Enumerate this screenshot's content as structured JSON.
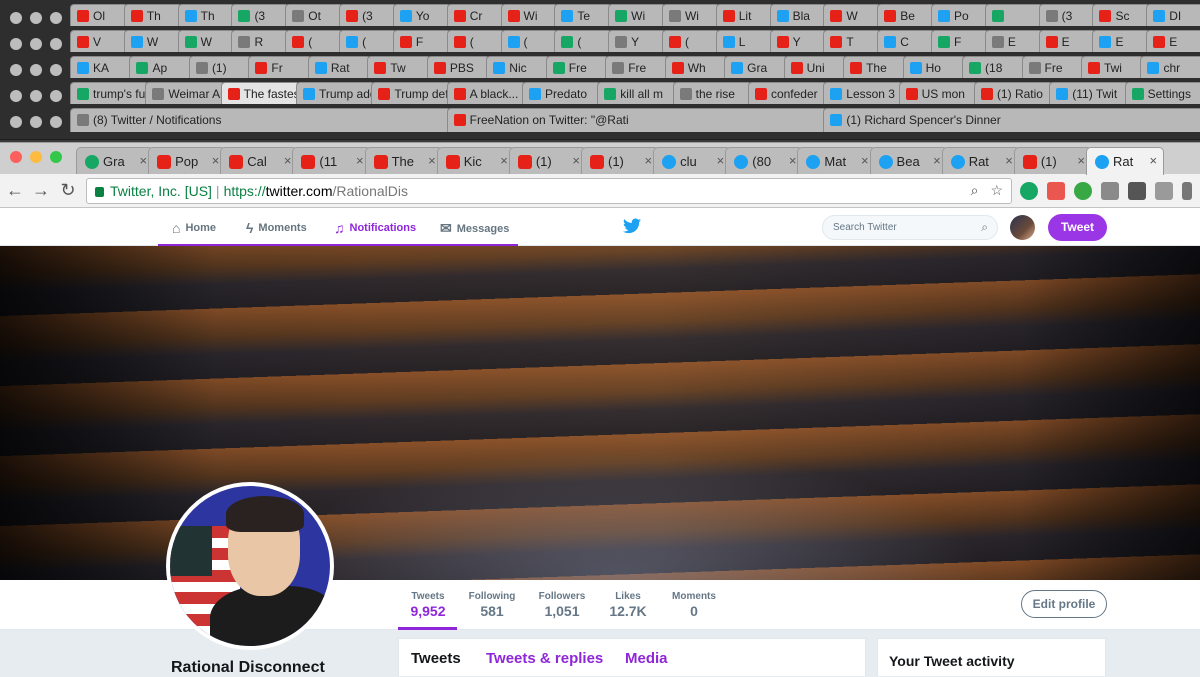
{
  "background_windows": [
    {
      "tabs": [
        "Ol",
        "Th",
        "Th",
        "(3",
        "Ot",
        "(3",
        "Yo",
        "Cr",
        "Wi",
        "Te",
        "Wi",
        "Wi",
        "Lit",
        "Bla",
        "W",
        "Be",
        "Po",
        "",
        "(3",
        "Sc",
        "DI"
      ]
    },
    {
      "tabs": [
        "V",
        "W",
        "W",
        "R",
        "(",
        "(",
        "F",
        "(",
        "(",
        "(",
        "Y",
        "(",
        "L",
        "Y",
        "T",
        "C",
        "F",
        "E",
        "E",
        "E",
        "E"
      ]
    },
    {
      "tabs": [
        "KA",
        "Ap",
        "(1)",
        "Fr",
        "Rat",
        "Tw",
        "PBS",
        "Nic",
        "Fre",
        "Fre",
        "Wh",
        "Gra",
        "Uni",
        "The",
        "Ho",
        "(18",
        "Fre",
        "Twi",
        "chr"
      ]
    },
    {
      "tabs": [
        "trump's full response to ch",
        "Weimar America - YouTube",
        "The fastest free YouTube D",
        "Trump addresses Charlotte",
        "Trump defends Charlottesvil",
        "A black...",
        "Predato",
        "kill all m",
        "the rise",
        "confeder",
        "Lesson 3",
        "US mon",
        "(1) Ratio",
        "(11) Twit",
        "Settings"
      ]
    },
    {
      "tabs": [
        "(8) Twitter / Notifications",
        "FreeNation on Twitter: \"@Rati",
        "(1) Richard Spencer's Dinner"
      ]
    }
  ],
  "active_tabs": [
    {
      "label": "Gra",
      "icon": "grammarly-icon"
    },
    {
      "label": "Pop",
      "icon": "youtube-icon"
    },
    {
      "label": "Cal",
      "icon": "youtube-icon"
    },
    {
      "label": "(11",
      "icon": "youtube-icon"
    },
    {
      "label": "The",
      "icon": "youtube-icon"
    },
    {
      "label": "Kic",
      "icon": "youtube-icon"
    },
    {
      "label": "(1)",
      "icon": "youtube-icon"
    },
    {
      "label": "(1)",
      "icon": "youtube-icon"
    },
    {
      "label": "clu",
      "icon": "twitter-icon"
    },
    {
      "label": "(80",
      "icon": "twitter-icon"
    },
    {
      "label": "Mat",
      "icon": "twitter-icon"
    },
    {
      "label": "Bea",
      "icon": "twitter-icon"
    },
    {
      "label": "Rat",
      "icon": "twitter-icon"
    },
    {
      "label": "(1)",
      "icon": "youtube-icon"
    },
    {
      "label": "Rat",
      "icon": "twitter-icon"
    }
  ],
  "tab_close_glyph": "×",
  "address_bar": {
    "secure_label": "Twitter, Inc. [US]",
    "separator": "|",
    "protocol": "https://",
    "host": "twitter.com",
    "path": "/RationalDis"
  },
  "nav": {
    "home": "Home",
    "moments": "Moments",
    "notifications": "Notifications",
    "messages": "Messages",
    "search_placeholder": "Search Twitter",
    "tweet_button": "Tweet"
  },
  "profile": {
    "name": "Rational Disconnect",
    "edit_button": "Edit profile",
    "stats": [
      {
        "label": "Tweets",
        "value": "9,952"
      },
      {
        "label": "Following",
        "value": "581"
      },
      {
        "label": "Followers",
        "value": "1,051"
      },
      {
        "label": "Likes",
        "value": "12.7K"
      },
      {
        "label": "Moments",
        "value": "0"
      }
    ]
  },
  "timeline_tabs": {
    "tweets": "Tweets",
    "replies": "Tweets & replies",
    "media": "Media"
  },
  "sidebar": {
    "activity_title": "Your Tweet activity"
  },
  "colors": {
    "accent": "#8f26d9",
    "tweet_button": "#9b36e6",
    "twitter_blue": "#1da1f2"
  }
}
